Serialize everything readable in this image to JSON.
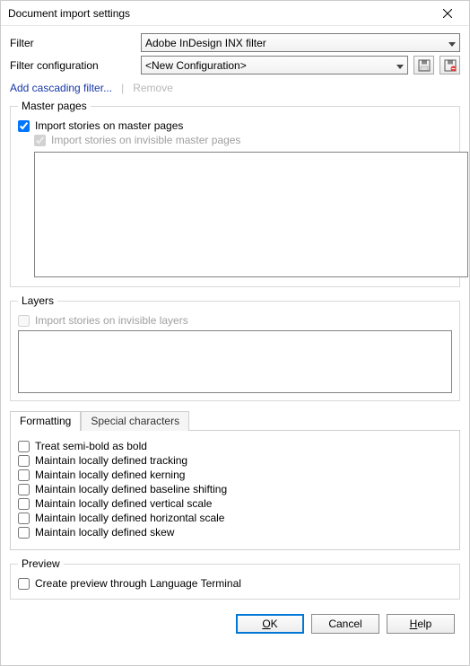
{
  "window": {
    "title": "Document import settings"
  },
  "fields": {
    "filter_label": "Filter",
    "filter_value": "Adobe InDesign INX filter",
    "filter_config_label": "Filter configuration",
    "filter_config_value": "<New Configuration>"
  },
  "links": {
    "add_cascading": "Add cascading filter...",
    "separator": "|",
    "remove": "Remove"
  },
  "groups": {
    "master_pages": {
      "legend": "Master pages",
      "import_master": "Import stories on master pages",
      "import_invisible_master": "Import stories on invisible master pages"
    },
    "layers": {
      "legend": "Layers",
      "import_invisible_layers": "Import stories on invisible layers"
    },
    "preview": {
      "legend": "Preview",
      "create_preview": "Create preview through Language Terminal"
    }
  },
  "tabs": {
    "formatting": "Formatting",
    "special_chars": "Special characters"
  },
  "formatting_options": {
    "semi_bold": "Treat semi-bold as bold",
    "tracking": "Maintain locally defined tracking",
    "kerning": "Maintain locally defined kerning",
    "baseline": "Maintain locally defined baseline shifting",
    "vscale": "Maintain locally defined vertical scale",
    "hscale": "Maintain locally defined horizontal scale",
    "skew": "Maintain locally defined skew"
  },
  "buttons": {
    "ok_u": "O",
    "ok_rest": "K",
    "cancel": "Cancel",
    "help_u": "H",
    "help_rest": "elp"
  }
}
